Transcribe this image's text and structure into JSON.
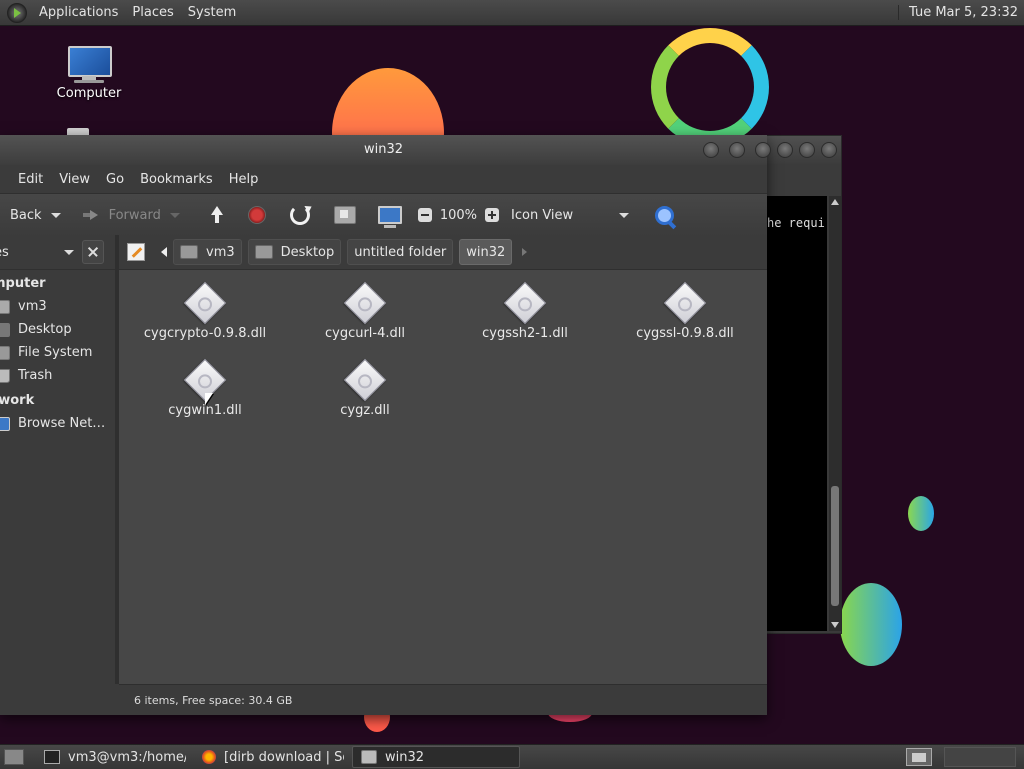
{
  "top_panel": {
    "menus": [
      "Applications",
      "Places",
      "System"
    ],
    "clock": "Tue Mar  5, 23:32"
  },
  "desktop": {
    "icons": [
      {
        "label": "Computer",
        "icon": "computer-icon"
      }
    ]
  },
  "terminal": {
    "visible_text": "he requi"
  },
  "file_manager": {
    "title": "win32",
    "menus": [
      "Edit",
      "View",
      "Go",
      "Bookmarks",
      "Help"
    ],
    "toolbar": {
      "back_label": "Back",
      "forward_label": "Forward",
      "zoom_level": "100%",
      "view_mode": "Icon View"
    },
    "sidebar": {
      "combo_label": "es",
      "sections": [
        {
          "title": "mputer",
          "items": [
            {
              "label": "vm3",
              "icon": "home-folder-icon"
            },
            {
              "label": "Desktop",
              "icon": "desktop-folder-icon"
            },
            {
              "label": "File System",
              "icon": "drive-icon"
            },
            {
              "label": "Trash",
              "icon": "trash-icon"
            }
          ]
        },
        {
          "title": "twork",
          "items": [
            {
              "label": "Browse Net…",
              "icon": "network-icon"
            }
          ]
        }
      ]
    },
    "breadcrumbs": [
      {
        "label": "vm3",
        "icon": "home-folder-icon"
      },
      {
        "label": "Desktop",
        "icon": "desktop-folder-icon"
      },
      {
        "label": "untitled folder"
      },
      {
        "label": "win32",
        "active": true
      }
    ],
    "files": [
      {
        "name": "cygcrypto-0.9.8.dll"
      },
      {
        "name": "cygcurl-4.dll"
      },
      {
        "name": "cygssh2-1.dll"
      },
      {
        "name": "cygssl-0.9.8.dll"
      },
      {
        "name": "cygwin1.dll"
      },
      {
        "name": "cygz.dll"
      }
    ],
    "status": "6 items, Free space: 30.4 GB"
  },
  "taskbar": {
    "tasks": [
      {
        "label": "vm3@vm3:/home/v...",
        "icon": "terminal-icon"
      },
      {
        "label": "[dirb download | So...",
        "icon": "firefox-icon"
      },
      {
        "label": "win32",
        "icon": "folder-icon",
        "active": true
      }
    ]
  }
}
